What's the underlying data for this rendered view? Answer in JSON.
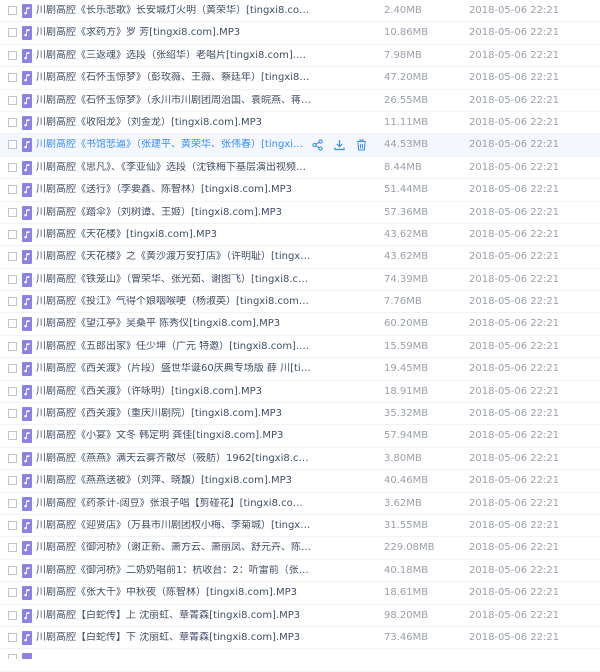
{
  "colors": {
    "music_icon": "#8c81e6",
    "hover_text": "#3b8cff",
    "meta_text": "#9aa0aa",
    "name_text": "#424e67"
  },
  "icons": {
    "file": "music-file-icon",
    "share": "share-icon",
    "download": "download-icon",
    "delete": "trash-icon"
  },
  "files": [
    {
      "name": "川剧高腔《长乐悲歌》长安城灯火明（黄荣华）[tingxi8.com]...",
      "size": "2.40MB",
      "date": "2018-05-06 22:21"
    },
    {
      "name": "川剧高腔《求药方》罗 芳[tingxi8.com].MP3",
      "size": "10.86MB",
      "date": "2018-05-06 22:21"
    },
    {
      "name": "川剧高腔《三返魂》选段（张绍华）老唱片[tingxi8.com].MP3",
      "size": "7.98MB",
      "date": "2018-05-06 22:21"
    },
    {
      "name": "川剧高腔《石怀玉惊梦》（彭玫薇、王薇、蔡廷年）[tingxi8.com]...",
      "size": "47.20MB",
      "date": "2018-05-06 22:21"
    },
    {
      "name": "川剧高腔《石怀玉惊梦》（永川市川剧团周治国、袁皖燕、蒋中...",
      "size": "26.55MB",
      "date": "2018-05-06 22:21"
    },
    {
      "name": "川剧高腔《收阳龙》（刘金龙）[tingxi8.com].MP3",
      "size": "11.11MB",
      "date": "2018-05-06 22:21"
    },
    {
      "name": "川剧高腔《书馆悲逼》（张建平、黄荣华、张伟春）[tingxi8.com...",
      "size": "44.53MB",
      "date": "2018-05-06 22:21"
    },
    {
      "name": "川剧高腔《思凡》、《李亚仙》选段（沈铁梅下基层演出视频）...",
      "size": "8.44MB",
      "date": "2018-05-06 22:21"
    },
    {
      "name": "川剧高腔《送行》（李要鑫、陈智林）[tingxi8.com].MP3",
      "size": "51.44MB",
      "date": "2018-05-06 22:21"
    },
    {
      "name": "川剧高腔《踏伞》（刘树谭、王姬）[tingxi8.com].MP3",
      "size": "57.36MB",
      "date": "2018-05-06 22:21"
    },
    {
      "name": "川剧高腔《天花楼》[tingxi8.com].MP3",
      "size": "43.62MB",
      "date": "2018-05-06 22:21"
    },
    {
      "name": "川剧高腔《天花楼》之《黄沙渡万安打店》（许明耻）[tingxi8.com]...",
      "size": "43.62MB",
      "date": "2018-05-06 22:21"
    },
    {
      "name": "川剧高腔《铁笼山》（曾荣华、张光茹、谢图飞）[tingxi8.com]...",
      "size": "74.39MB",
      "date": "2018-05-06 22:21"
    },
    {
      "name": "川剧高腔《投江》气得个娘咽喉哽（杨淑英）[tingxi8.com].MP3",
      "size": "7.76MB",
      "date": "2018-05-06 22:21"
    },
    {
      "name": "川剧高腔《望江亭》吴桑平 陈秀仪[tingxi8.com].MP3",
      "size": "60.20MB",
      "date": "2018-05-06 22:21"
    },
    {
      "name": "川剧高腔《五郎出家》任少坤（广元 特邀）[tingxi8.com].MP3",
      "size": "15.59MB",
      "date": "2018-05-06 22:21"
    },
    {
      "name": "川剧高腔《西关渡》（片段）盛世华诞60庆典专场版 薛 川[tingx...",
      "size": "19.45MB",
      "date": "2018-05-06 22:21"
    },
    {
      "name": "川剧高腔《西关渡》（许咏明）[tingxi8.com].MP3",
      "size": "18.91MB",
      "date": "2018-05-06 22:21"
    },
    {
      "name": "川剧高腔《西关渡》（重庆川剧院）[tingxi8.com].MP3",
      "size": "35.32MB",
      "date": "2018-05-06 22:21"
    },
    {
      "name": "川剧高腔《小宴》文冬 韩定明 龚佳[tingxi8.com].MP3",
      "size": "57.94MB",
      "date": "2018-05-06 22:21"
    },
    {
      "name": "川剧高腔《燕燕》满天云雾齐散尽（筱舫）1962[tingxi8.com].M...",
      "size": "3.80MB",
      "date": "2018-05-06 22:21"
    },
    {
      "name": "川剧高腔《燕燕送被》（刘萍、晓馥）[tingxi8.com].MP3",
      "size": "40.46MB",
      "date": "2018-05-06 22:21"
    },
    {
      "name": "川剧高腔《药茶计-阔豆》张浪子唱【剪碰花】[tingxi8.com].MP3",
      "size": "3.62MB",
      "date": "2018-05-06 22:21"
    },
    {
      "name": "川剧高腔《迎贤店》（万县市川剧团权小梅、李菊城）[tingxi8.com...",
      "size": "31.55MB",
      "date": "2018-05-06 22:21"
    },
    {
      "name": "川剧高腔《御河桥》（谢正新、萧方云、萧丽凤、舒元卉、陈毅...",
      "size": "229.08MB",
      "date": "2018-05-06 22:21"
    },
    {
      "name": "川剧高腔《御河桥》二奶奶唱前1：杭收台：2：听雷前（张光...",
      "size": "40.18MB",
      "date": "2018-05-06 22:21"
    },
    {
      "name": "川剧高腔《张大千》中秋夜（陈智林）[tingxi8.com].MP3",
      "size": "18.61MB",
      "date": "2018-05-06 22:21"
    },
    {
      "name": "川剧高腔【白蛇传】上 沈丽虹、章箐森[tingxi8.com].MP3",
      "size": "98.20MB",
      "date": "2018-05-06 22:21"
    },
    {
      "name": "川剧高腔【白蛇传】下 沈丽虹、章箐森[tingxi8.com].MP3",
      "size": "73.46MB",
      "date": "2018-05-06 22:21"
    }
  ]
}
